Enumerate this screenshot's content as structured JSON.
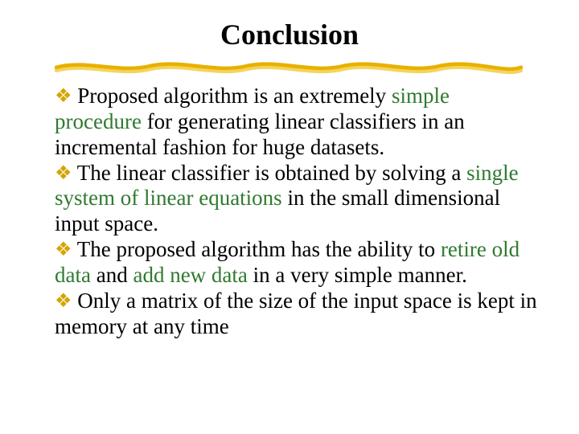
{
  "title": "Conclusion",
  "bullets": [
    {
      "pre": " Proposed algorithm is an extremely ",
      "hl1": "simple procedure",
      "post": " for generating linear classifiers in an incremental fashion for huge datasets."
    },
    {
      "pre": " The linear  classifier is obtained by solving a ",
      "hl1": "single system of linear equations",
      "post": " in the small dimensional input space."
    },
    {
      "pre": " The proposed algorithm has the ability to ",
      "hl1": "retire old data",
      "mid": " and ",
      "hl2": "add new data",
      "post": " in a very simple manner."
    },
    {
      "pre": " Only a matrix of the size of the input space is kept in memory at any time",
      "hl1": "",
      "post": ""
    }
  ]
}
